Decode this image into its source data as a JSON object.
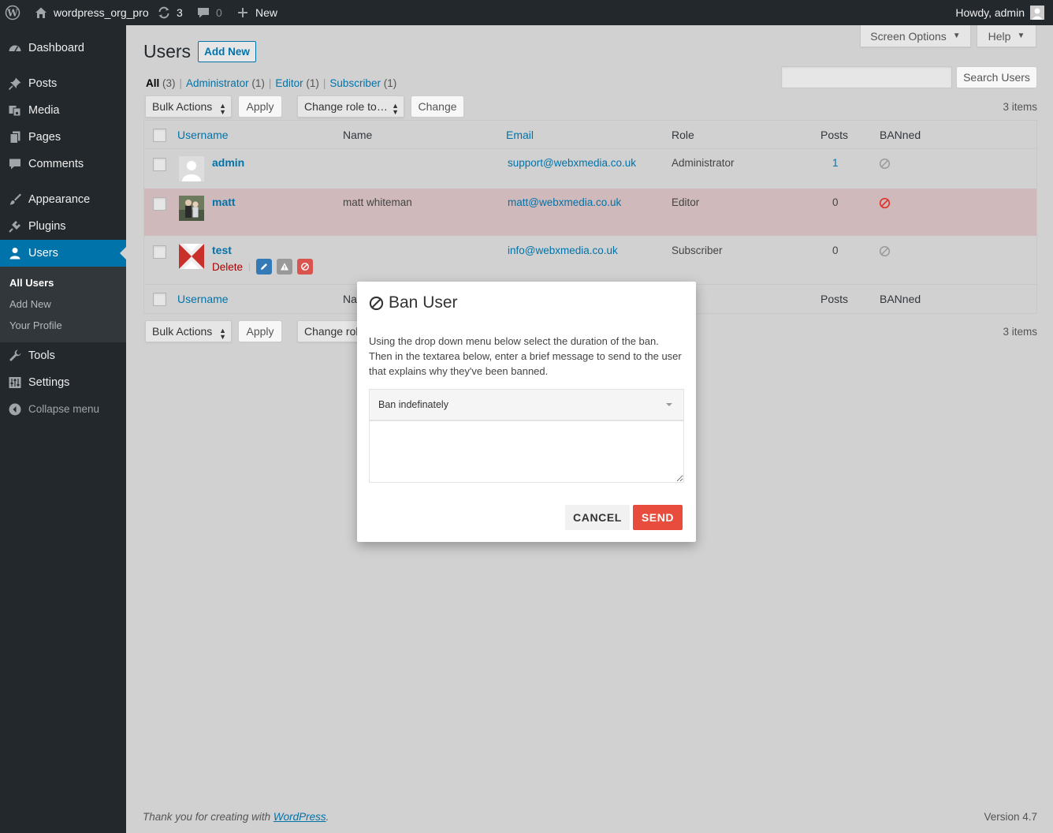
{
  "adminbar": {
    "site_name": "wordpress_org_pro",
    "updates_count": "3",
    "comments_count": "0",
    "new_label": "New",
    "howdy": "Howdy, admin"
  },
  "sidebar": {
    "items": [
      {
        "label": "Dashboard",
        "icon": "dashboard-icon"
      },
      {
        "label": "Posts",
        "icon": "pushpin-icon"
      },
      {
        "label": "Media",
        "icon": "media-icon"
      },
      {
        "label": "Pages",
        "icon": "pages-icon"
      },
      {
        "label": "Comments",
        "icon": "comments-icon"
      },
      {
        "label": "Appearance",
        "icon": "paintbrush-icon"
      },
      {
        "label": "Plugins",
        "icon": "plugin-icon"
      },
      {
        "label": "Users",
        "icon": "user-icon"
      },
      {
        "label": "Tools",
        "icon": "wrench-icon"
      },
      {
        "label": "Settings",
        "icon": "settings-icon"
      },
      {
        "label": "Collapse menu",
        "icon": "collapse-icon"
      }
    ],
    "submenu": [
      "All Users",
      "Add New",
      "Your Profile"
    ]
  },
  "top_tabs": {
    "screen_options": "Screen Options",
    "help": "Help"
  },
  "page": {
    "title": "Users",
    "add_new": "Add New",
    "filters": [
      {
        "label": "All",
        "count": "(3)"
      },
      {
        "label": "Administrator",
        "count": "(1)"
      },
      {
        "label": "Editor",
        "count": "(1)"
      },
      {
        "label": "Subscriber",
        "count": "(1)"
      }
    ],
    "search_value": "",
    "search_button": "Search Users",
    "items_count": "3 items",
    "bulk_actions": "Bulk Actions",
    "apply": "Apply",
    "change_role": "Change role to…",
    "change_role_truncated": "Change rol",
    "change": "Change"
  },
  "table": {
    "columns": {
      "username": "Username",
      "name": "Name",
      "email": "Email",
      "role": "Role",
      "posts": "Posts",
      "banned": "BANned"
    },
    "footer_name_truncated": "Na",
    "rows": [
      {
        "username": "admin",
        "name": "",
        "email": "support@webxmedia.co.uk",
        "role": "Administrator",
        "posts": "1",
        "banned": false
      },
      {
        "username": "matt",
        "name": "matt whiteman",
        "email": "matt@webxmedia.co.uk",
        "role": "Editor",
        "posts": "0",
        "banned": true
      },
      {
        "username": "test",
        "name": "",
        "email": "info@webxmedia.co.uk",
        "role": "Subscriber",
        "posts": "0",
        "banned": false,
        "row_action_delete": "Delete"
      }
    ]
  },
  "modal": {
    "title": "Ban User",
    "description": "Using the drop down menu below select the duration of the ban. Then in the textarea below, enter a brief message to send to the user that explains why they've been banned.",
    "select_value": "Ban indefinately",
    "message": "",
    "cancel": "CANCEL",
    "send": "SEND"
  },
  "footer": {
    "thanks_prefix": "Thank you for creating with ",
    "thanks_link": "WordPress",
    "thanks_suffix": ".",
    "version": "Version 4.7"
  },
  "colors": {
    "link": "#0073aa",
    "sidebar_bg": "#23282d",
    "active_menu": "#0073aa",
    "banned_row": "#d0b9bb",
    "danger": "#e74c3c"
  }
}
